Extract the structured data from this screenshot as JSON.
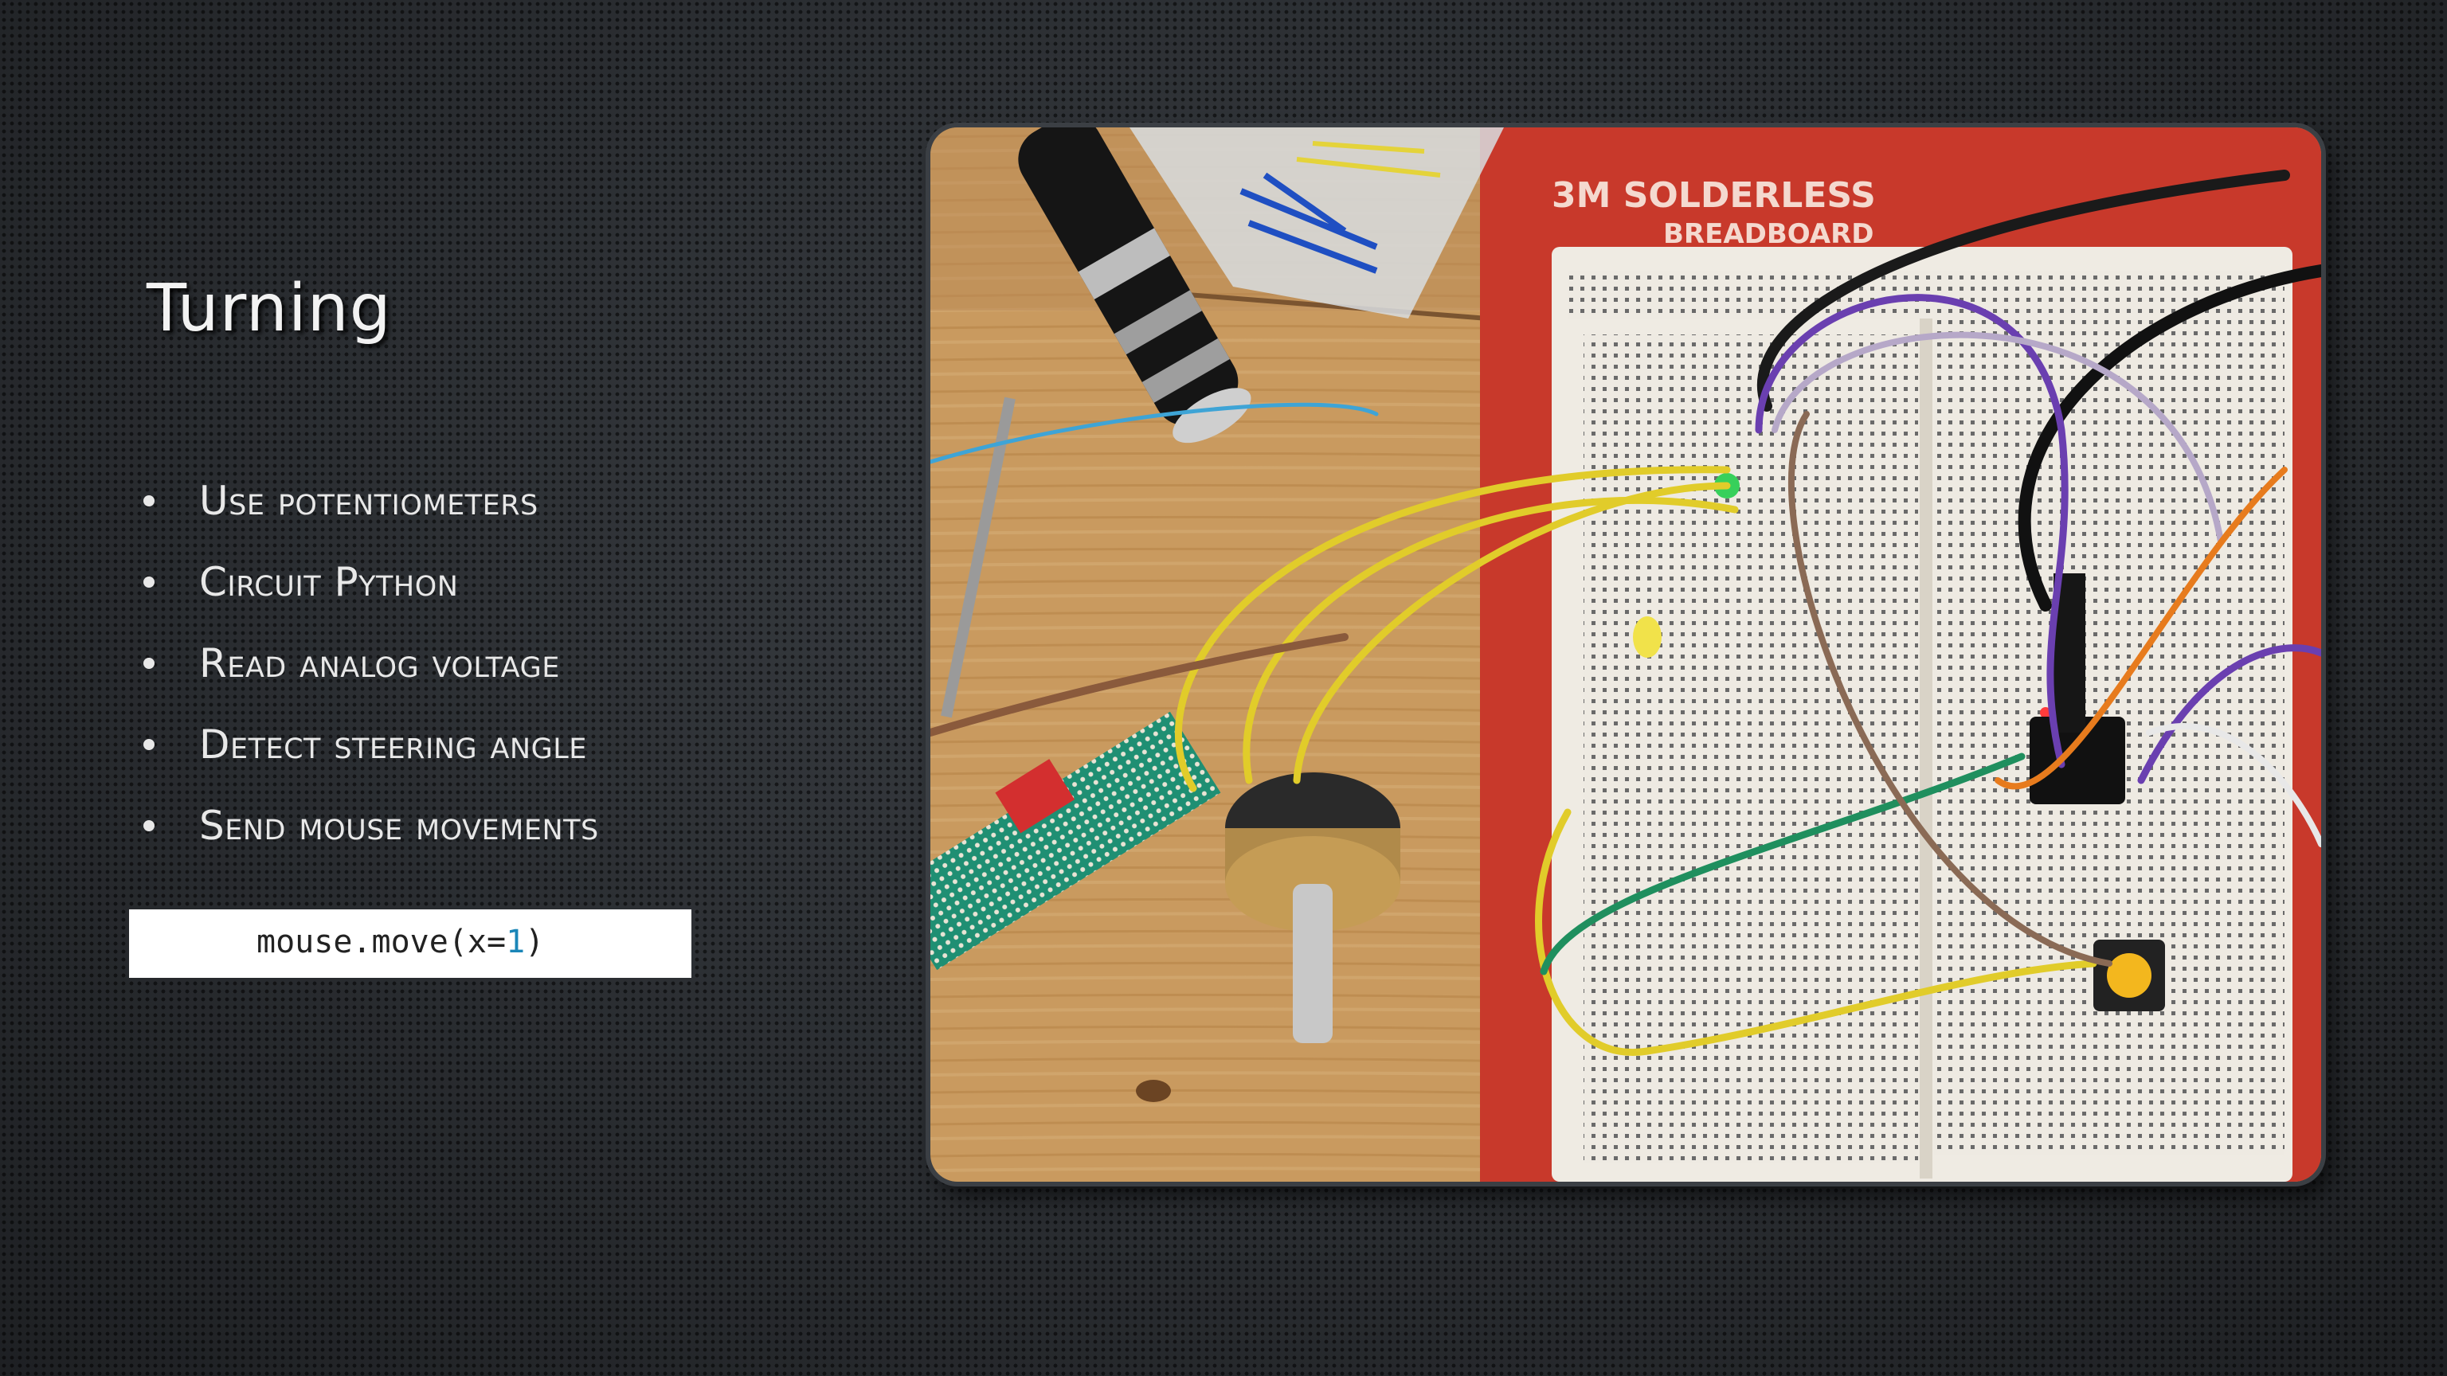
{
  "slide": {
    "title": "Turning",
    "bullets": [
      "Use potentiometers",
      "Circuit Python",
      "Read analog voltage",
      "Detect steering angle",
      "Send mouse movements"
    ],
    "code": {
      "prefix": "mouse.move(x=",
      "number": "1",
      "suffix": ")"
    }
  },
  "photo": {
    "breadboard_label_line1": "3M SOLDERLESS",
    "breadboard_label_line2": "BREADBOARD"
  },
  "colors": {
    "background": "#2a2d30",
    "title": "#f2f2f2",
    "bullet_text": "#e8e8e8",
    "code_number": "#1b86b8",
    "breadboard_base": "#c8392b",
    "wood": "#c9995e"
  }
}
